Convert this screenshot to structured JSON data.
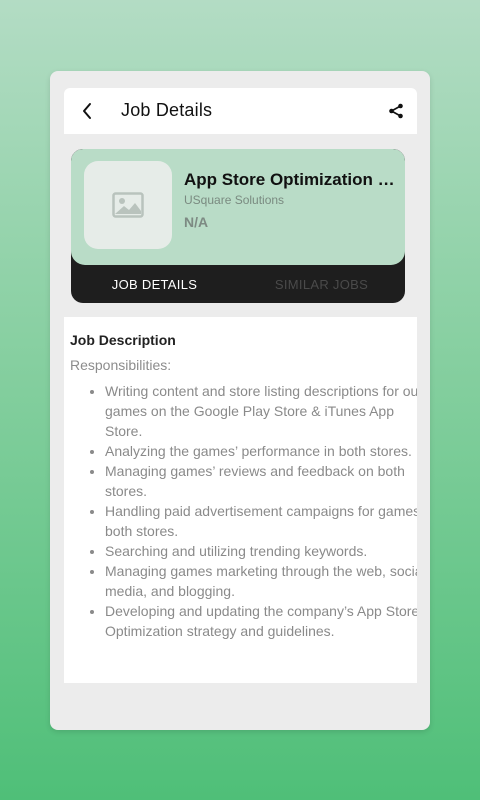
{
  "header": {
    "title": "Job Details"
  },
  "job": {
    "title": "App Store Optimization (…",
    "company": "USquare Solutions",
    "salary": "N/A"
  },
  "tabs": [
    {
      "label": "JOB DETAILS",
      "active": true
    },
    {
      "label": "SIMILAR JOBS",
      "active": false
    }
  ],
  "description": {
    "heading": "Job Description",
    "subheading": "Responsibilities:",
    "items": [
      "Writing content and store listing descriptions for our games on the Google Play Store & iTunes App Store.",
      "Analyzing the games’ performance in both stores.",
      "Managing games’ reviews and feedback on both stores.",
      "Handling paid advertisement campaigns for games in both stores.",
      "Searching and utilizing trending keywords.",
      "Managing games marketing through the web, social media, and blogging.",
      "Developing and updating the company’s App Store Optimization strategy and guidelines."
    ]
  },
  "colors": {
    "card_accent": "#b9dcc7",
    "tab_bar": "#1e1e1e",
    "background_gradient_bottom": "#4fbf78"
  },
  "icons": {
    "back": "back-arrow-icon",
    "share": "share-icon",
    "placeholder": "image-placeholder-icon"
  }
}
